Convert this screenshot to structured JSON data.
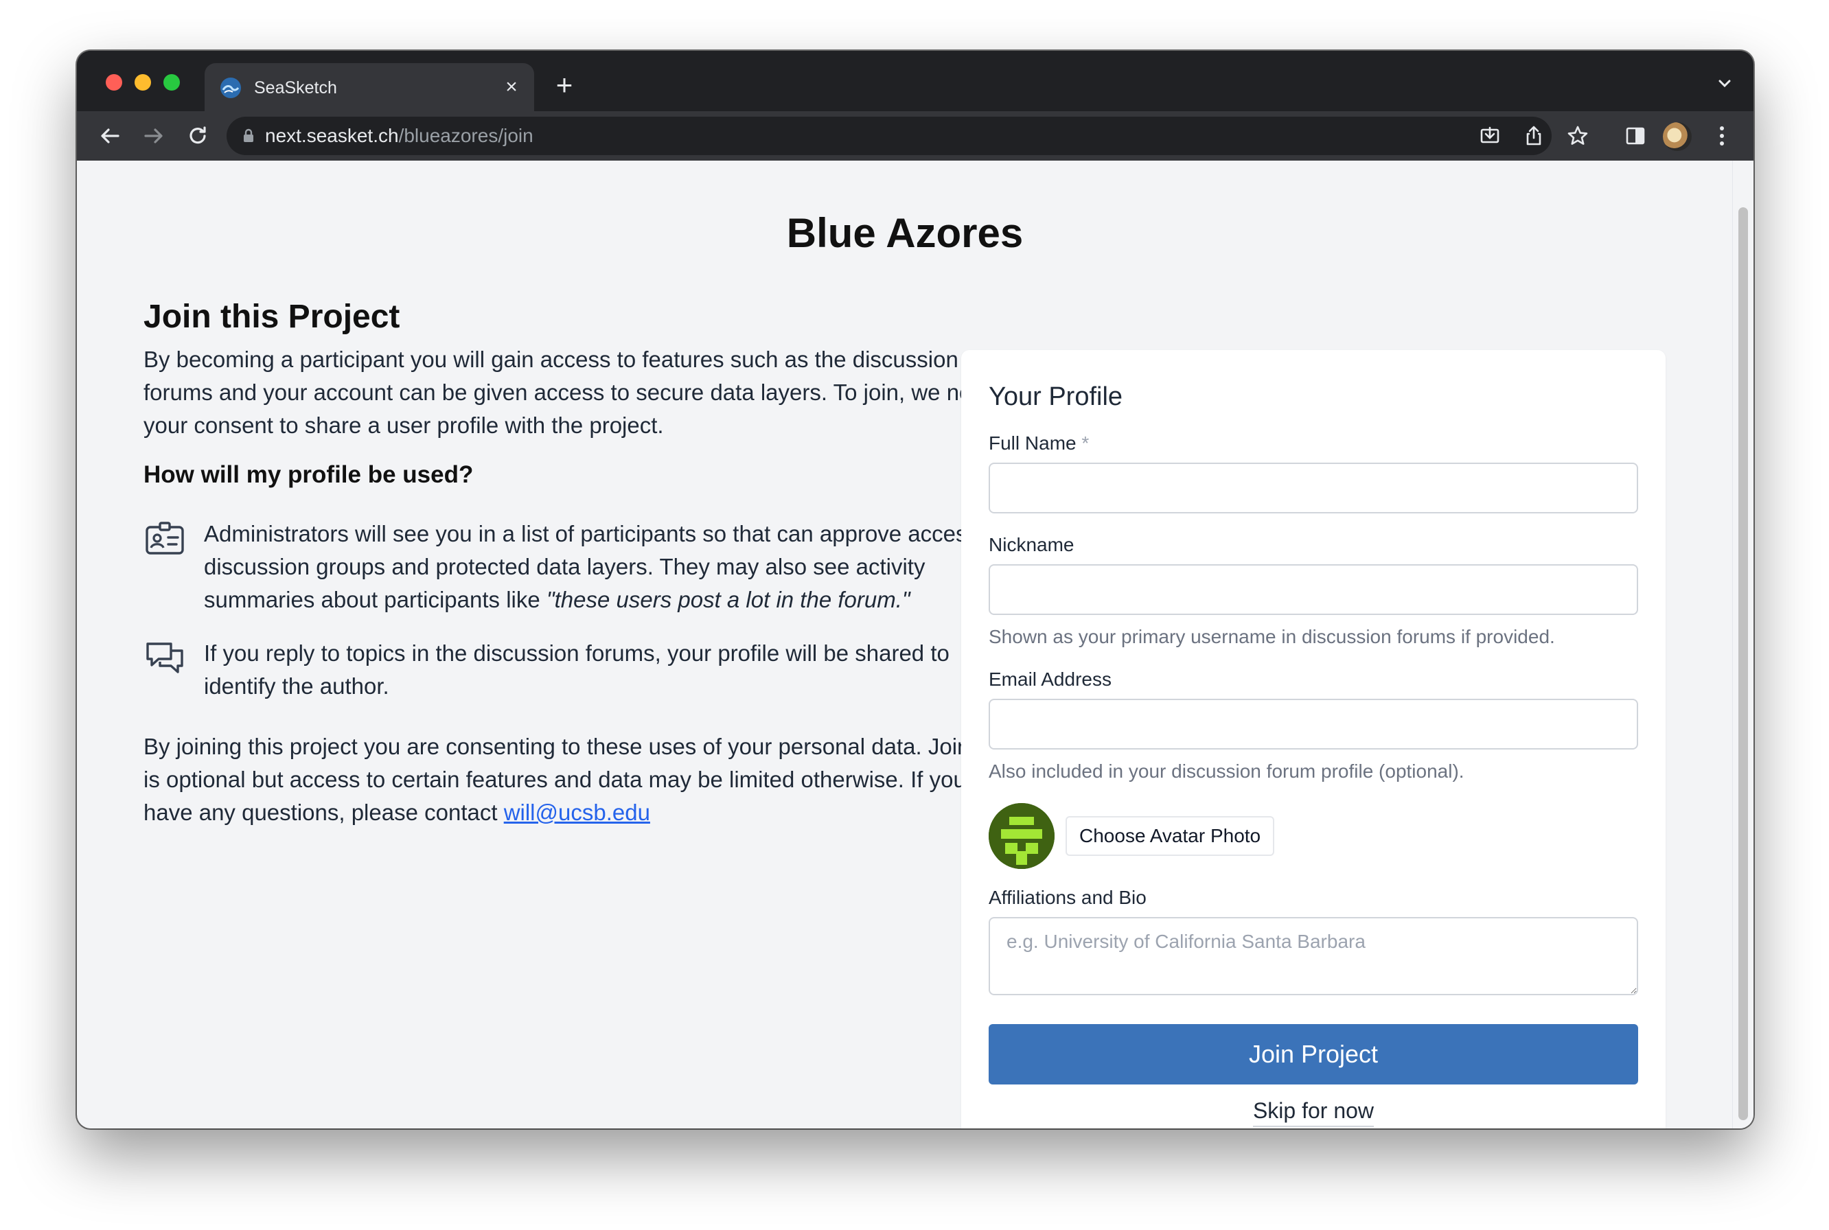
{
  "browser": {
    "tab_title": "SeaSketch",
    "tab_close": "×",
    "new_tab": "+",
    "url_host": "next.seasket.ch",
    "url_path": "/blueazores/join"
  },
  "page": {
    "title": "Blue Azores"
  },
  "join_section": {
    "heading": "Join this Project",
    "intro": "By becoming a participant you will gain access to features such as the discussion forums and your account can be given access to secure data layers. To join, we need your consent to share a user profile with the project.",
    "profile_heading": "How will my profile be used?",
    "admin_text": "Administrators will see you in a list of participants so that can approve access to discussion groups and protected data layers. They may also see activity summaries about participants like ",
    "admin_quote": "\"these users post a lot in the forum.\"",
    "forum_text": "If you reply to topics in the discussion forums, your profile will be shared to identify the author.",
    "consent_text": "By joining this project you are consenting to these uses of your personal data. Joining is optional but access to certain features and data may be limited otherwise. If you have any questions, please contact ",
    "contact_email": "will@ucsb.edu"
  },
  "profile_form": {
    "title": "Your Profile",
    "full_name_label": "Full Name",
    "required_mark": "*",
    "full_name_value": "",
    "nickname_label": "Nickname",
    "nickname_value": "",
    "nickname_hint": "Shown as your primary username in discussion forums if provided.",
    "email_label": "Email Address",
    "email_value": "",
    "email_hint": "Also included in your discussion forum profile (optional).",
    "avatar_button": "Choose Avatar Photo",
    "bio_label": "Affiliations and Bio",
    "bio_placeholder": "e.g. University of California Santa Barbara",
    "join_button": "Join Project",
    "skip_link": "Skip for now"
  },
  "colors": {
    "primary_button": "#3b73b9",
    "link": "#2563eb",
    "page_bg": "#f3f4f6",
    "avatar_bg": "#3f6212",
    "avatar_fg": "#a3e635"
  },
  "icons": {
    "tab_favicon": "seasketch-logo-icon",
    "admin_item": "id-card-icon",
    "forum_item": "chat-bubbles-icon"
  }
}
